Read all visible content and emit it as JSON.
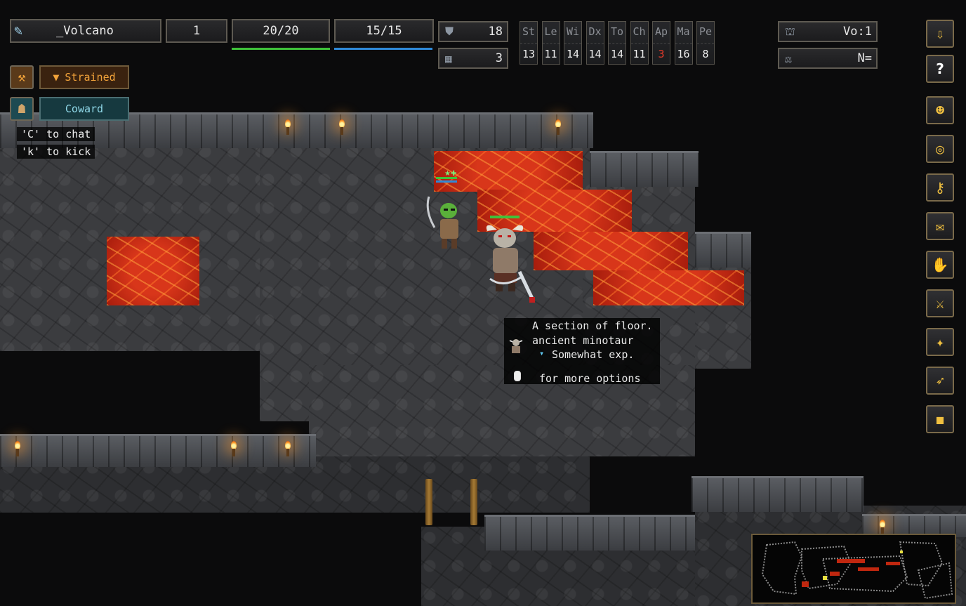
{
  "hud": {
    "name": "_Volcano",
    "level": "1",
    "hp": "20/20",
    "mp": "15/15",
    "ac": "18",
    "sh": "3",
    "stats": [
      {
        "label": "St",
        "value": "13",
        "color": "#eeeeee"
      },
      {
        "label": "Le",
        "value": "11",
        "color": "#eeeeee"
      },
      {
        "label": "Wi",
        "value": "14",
        "color": "#eeeeee"
      },
      {
        "label": "Dx",
        "value": "14",
        "color": "#eeeeee"
      },
      {
        "label": "To",
        "value": "14",
        "color": "#eeeeee"
      },
      {
        "label": "Ch",
        "value": "11",
        "color": "#eeeeee"
      },
      {
        "label": "Ap",
        "value": "3",
        "color": "#e53a2a"
      },
      {
        "label": "Ma",
        "value": "16",
        "color": "#eeeeee"
      },
      {
        "label": "Pe",
        "value": "8",
        "color": "#eeeeee"
      }
    ],
    "dungeon_level": "Vo:1",
    "alignment": "N=",
    "hp_fill": 1.0,
    "mp_fill": 1.0,
    "hp_color": "#3fc23a",
    "mp_color": "#2f8ad8"
  },
  "statuses": [
    {
      "label": "Strained",
      "color": "#f2a33a",
      "icon": "warning-icon"
    },
    {
      "label": "Coward",
      "color": "#8fd8e8",
      "icon": "coward-icon"
    }
  ],
  "hints": [
    "'C' to chat",
    "'k' to kick"
  ],
  "tooltip": {
    "line1": "A section of floor.",
    "line2": "ancient minotaur",
    "line3": "Somewhat exp.",
    "line4": "for more options"
  },
  "toolbar": [
    {
      "name": "save-book-icon",
      "glyph": "⇩"
    },
    {
      "name": "help-icon",
      "glyph": "?"
    },
    {
      "name": "character-portrait-icon",
      "glyph": "☻"
    },
    {
      "name": "magnifier-icon",
      "glyph": "◎"
    },
    {
      "name": "key-icon",
      "glyph": "⚷"
    },
    {
      "name": "chat-bubble-icon",
      "glyph": "✉"
    },
    {
      "name": "pray-icon",
      "glyph": "✋"
    },
    {
      "name": "sword-icon",
      "glyph": "⚔"
    },
    {
      "name": "wand-icon",
      "glyph": "✦"
    },
    {
      "name": "arrow-icon",
      "glyph": "➶"
    },
    {
      "name": "bag-icon",
      "glyph": "◼"
    }
  ],
  "colors": {
    "lava": "#c0270f",
    "floor": "#3b3c3f",
    "wall": "#4e5055",
    "accent": "#f0c040"
  }
}
